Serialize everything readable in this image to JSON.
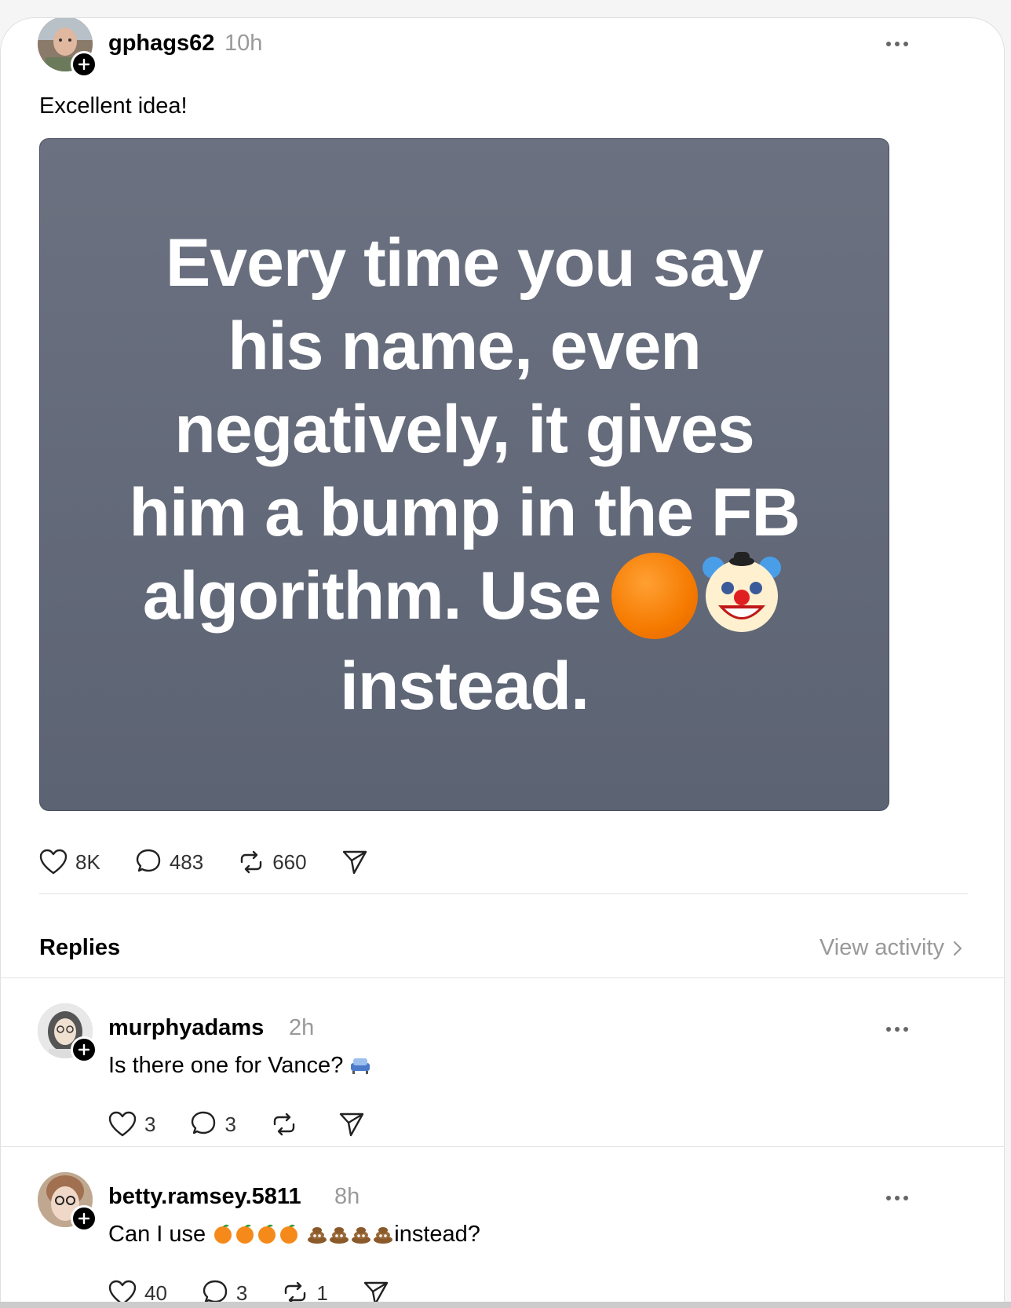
{
  "post": {
    "username": "gphags62",
    "time": "10h",
    "text": "Excellent idea!",
    "media_text": "Every time you say his name, even negatively, it gives him a bump in the FB algorithm. Use",
    "media_text_end": "instead.",
    "likes": "8K",
    "comments": "483",
    "reposts": "660"
  },
  "replies_section": {
    "title": "Replies",
    "view_activity": "View activity"
  },
  "replies": [
    {
      "username": "murphyadams",
      "time": "2h",
      "text": "Is there one for Vance?",
      "likes": "3",
      "comments": "3",
      "reposts": ""
    },
    {
      "username": "betty.ramsey.5811",
      "time": "8h",
      "text_prefix": "Can I use",
      "text_suffix": "instead?",
      "likes": "40",
      "comments": "3",
      "reposts": "1"
    }
  ],
  "icons": {
    "like": "heart-icon",
    "comment": "comment-icon",
    "repost": "repost-icon",
    "share": "send-icon",
    "more": "more-icon",
    "follow": "plus-icon"
  }
}
